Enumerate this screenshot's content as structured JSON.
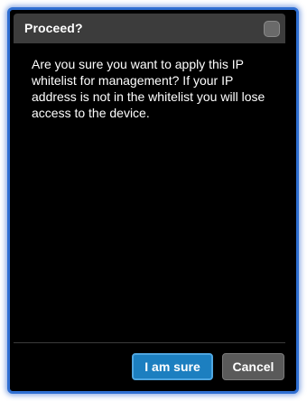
{
  "dialog": {
    "title": "Proceed?",
    "message": "Are you sure you want to apply this IP whitelist for management? If your IP address is not in the whitelist you will lose access to the device.",
    "buttons": {
      "confirm_label": "I am sure",
      "cancel_label": "Cancel"
    }
  },
  "colors": {
    "frame_border": "#2f6fd2",
    "title_bar": "#3c3c3c",
    "body_background": "#000000",
    "primary_button": "#1c7fc0",
    "secondary_button": "#5a5a5a"
  },
  "icons": {
    "close": "close-icon"
  }
}
